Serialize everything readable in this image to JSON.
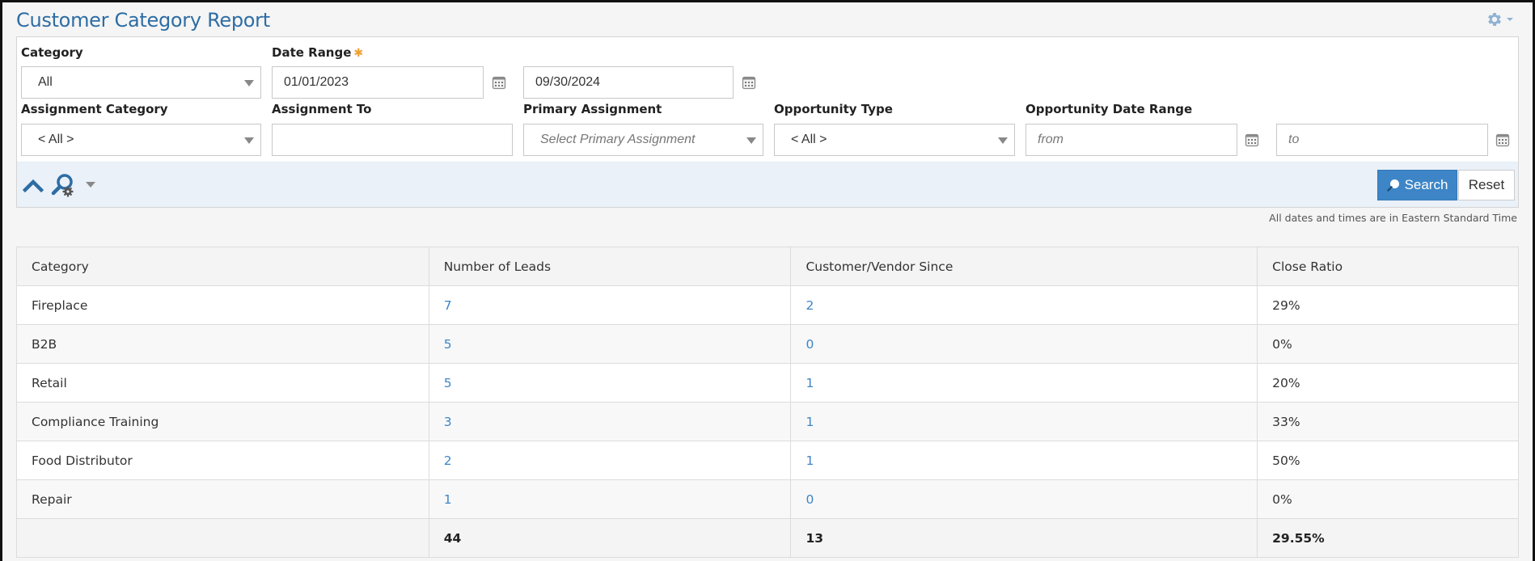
{
  "header": {
    "title": "Customer Category Report",
    "settings_icon": "gear-icon"
  },
  "filters": {
    "category": {
      "label": "Category",
      "value": "All"
    },
    "date_range": {
      "label": "Date Range",
      "required_mark": "✱",
      "from": "01/01/2023",
      "to": "09/30/2024"
    },
    "assignment_category": {
      "label": "Assignment Category",
      "value": "< All >"
    },
    "assignment_to": {
      "label": "Assignment To",
      "value": ""
    },
    "primary_assignment": {
      "label": "Primary Assignment",
      "placeholder": "Select Primary Assignment"
    },
    "opportunity_type": {
      "label": "Opportunity Type",
      "value": "< All >"
    },
    "opportunity_date_range": {
      "label": "Opportunity Date Range",
      "from_placeholder": "from",
      "to_placeholder": "to"
    }
  },
  "toolbar": {
    "collapse_icon": "chevron-up-icon",
    "search_settings_icon": "search-settings-icon",
    "search_label": "Search",
    "reset_label": "Reset"
  },
  "timezone_note": "All dates and times are in Eastern Standard Time",
  "colors": {
    "accent": "#3d85c6",
    "title": "#2e6da4",
    "required": "#f0a030",
    "toolbar_bg": "#eaf1f9"
  },
  "table": {
    "columns": [
      "Category",
      "Number of Leads",
      "Customer/Vendor Since",
      "Close Ratio"
    ],
    "rows": [
      {
        "category": "Fireplace",
        "leads": "7",
        "since": "2",
        "ratio": "29%"
      },
      {
        "category": "B2B",
        "leads": "5",
        "since": "0",
        "ratio": "0%"
      },
      {
        "category": "Retail",
        "leads": "5",
        "since": "1",
        "ratio": "20%"
      },
      {
        "category": "Compliance Training",
        "leads": "3",
        "since": "1",
        "ratio": "33%"
      },
      {
        "category": "Food Distributor",
        "leads": "2",
        "since": "1",
        "ratio": "50%"
      },
      {
        "category": "Repair",
        "leads": "1",
        "since": "0",
        "ratio": "0%"
      }
    ],
    "totals": {
      "category": "",
      "leads": "44",
      "since": "13",
      "ratio": "29.55%"
    }
  }
}
